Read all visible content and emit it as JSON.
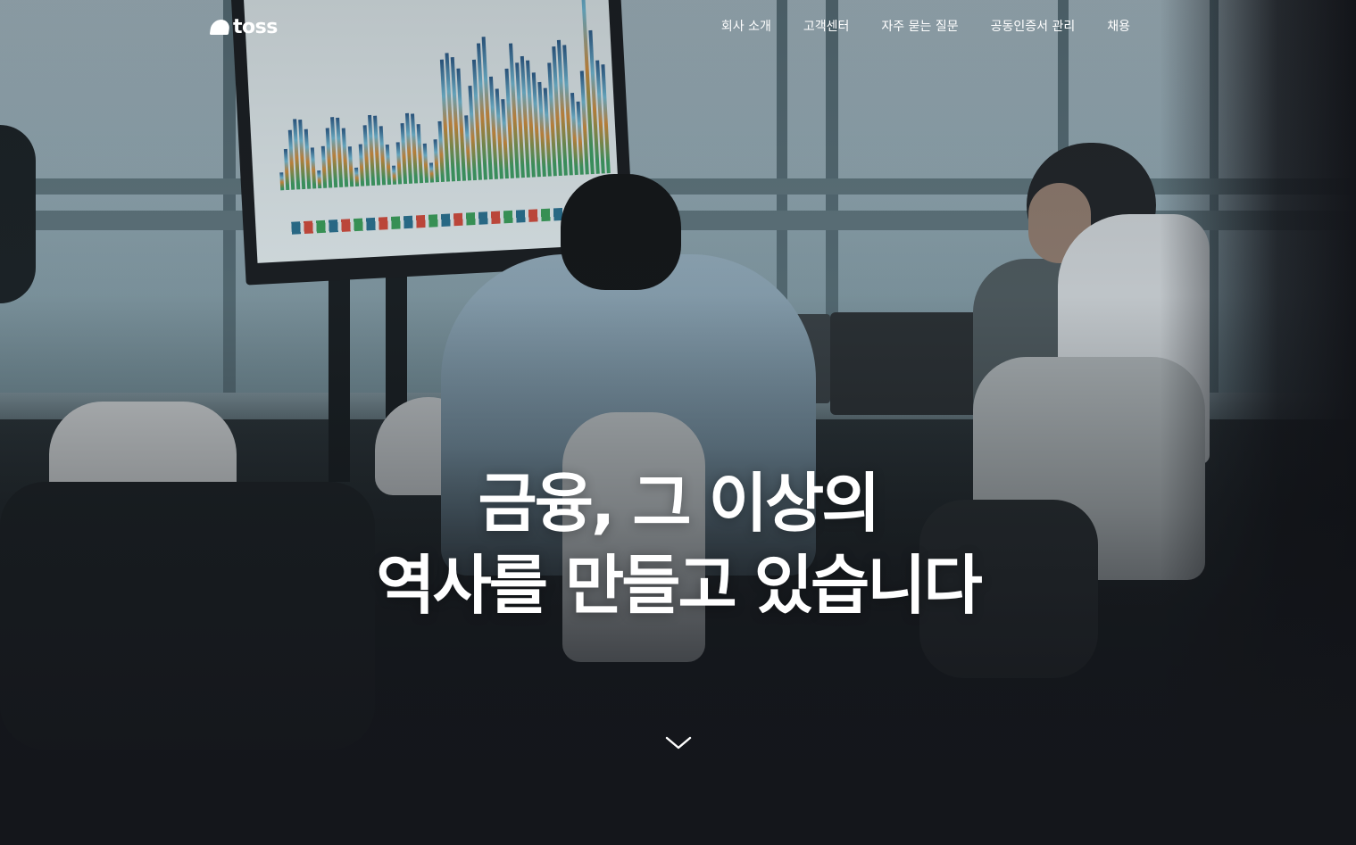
{
  "header": {
    "logo_text": "toss",
    "nav": [
      {
        "label": "회사 소개"
      },
      {
        "label": "고객센터"
      },
      {
        "label": "자주 묻는 질문"
      },
      {
        "label": "공동인증서 관리"
      },
      {
        "label": "채용"
      }
    ]
  },
  "hero": {
    "headline_line1": "금융, 그 이상의",
    "headline_line2": "역사를 만들고 있습니다",
    "scroll_icon": "chevron-down-icon"
  },
  "colors": {
    "background": "#14161b",
    "text": "#ffffff"
  }
}
